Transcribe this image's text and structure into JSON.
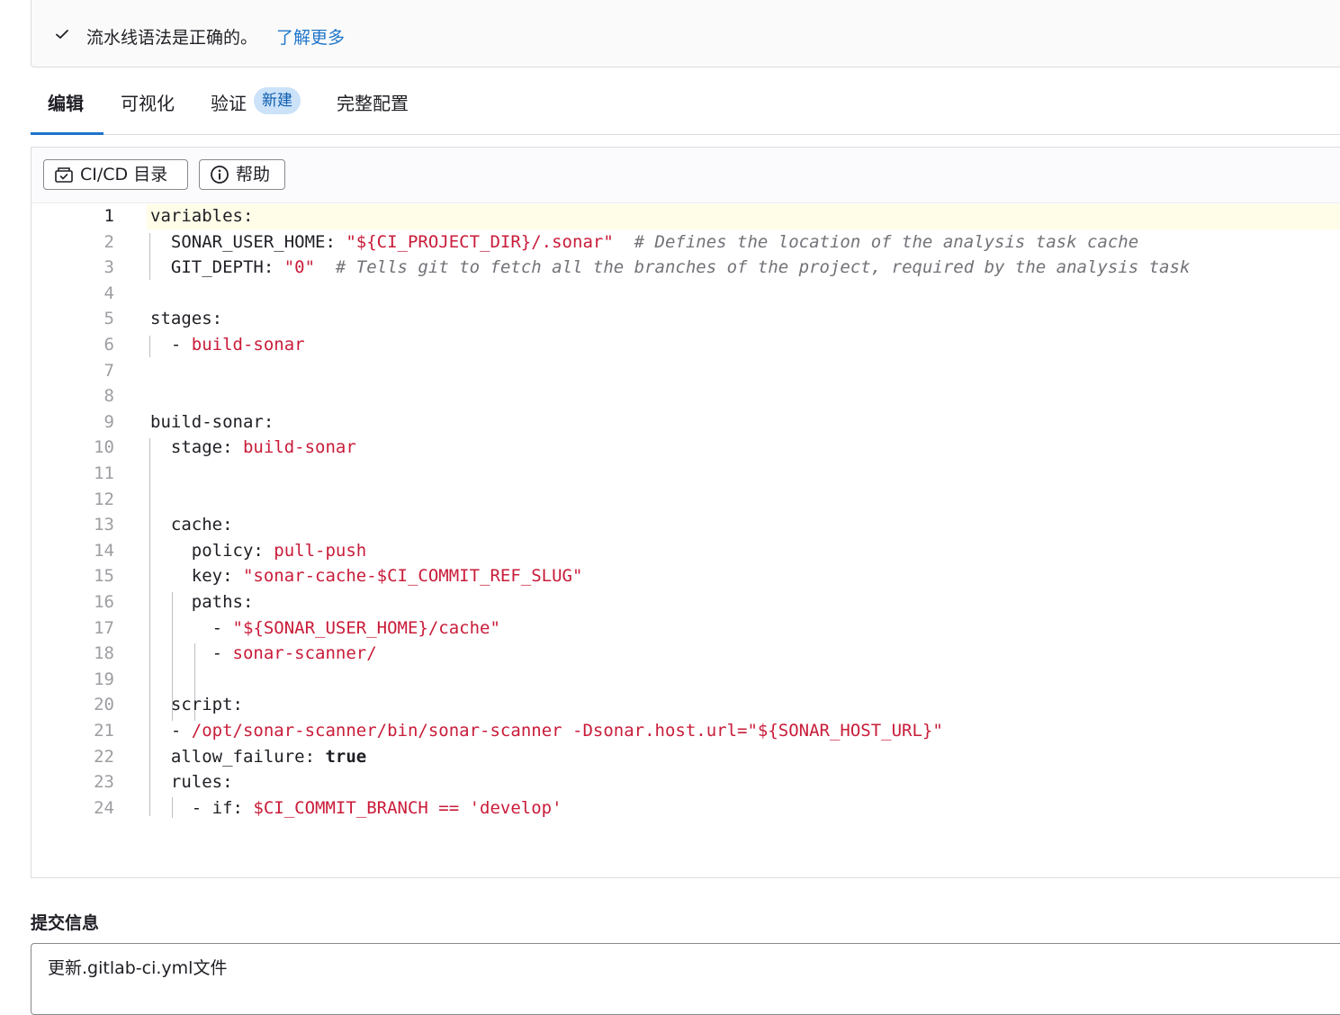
{
  "banner": {
    "message": "流水线语法是正确的。",
    "link": "了解更多"
  },
  "tabs": [
    {
      "label": "编辑"
    },
    {
      "label": "可视化"
    },
    {
      "label": "验证",
      "badge": "新建"
    },
    {
      "label": "完整配置"
    }
  ],
  "toolbar": {
    "catalog_label": "CI/CD 目录",
    "help_label": "帮助"
  },
  "editor": {
    "line_numbers": [
      "1",
      "2",
      "3",
      "4",
      "5",
      "6",
      "7",
      "8",
      "9",
      "10",
      "11",
      "12",
      "13",
      "14",
      "15",
      "16",
      "17",
      "18",
      "19",
      "20",
      "21",
      "22",
      "23",
      "24"
    ],
    "current_line": "1",
    "lines": [
      [
        {
          "t": "variables:",
          "k": "p"
        }
      ],
      [
        {
          "t": "  SONAR_USER_HOME: ",
          "k": "p"
        },
        {
          "t": "\"${CI_PROJECT_DIR}/.sonar\"",
          "k": "s"
        },
        {
          "t": "  # Defines the location of the analysis task cache",
          "k": "c"
        }
      ],
      [
        {
          "t": "  GIT_DEPTH: ",
          "k": "p"
        },
        {
          "t": "\"0\"",
          "k": "s"
        },
        {
          "t": "  # Tells git to fetch all the branches of the project, required by the analysis task",
          "k": "c"
        }
      ],
      [],
      [
        {
          "t": "stages:",
          "k": "p"
        }
      ],
      [
        {
          "t": "  - ",
          "k": "p"
        },
        {
          "t": "build-sonar",
          "k": "s"
        }
      ],
      [],
      [],
      [
        {
          "t": "build-sonar:",
          "k": "p"
        }
      ],
      [
        {
          "t": "  stage: ",
          "k": "p"
        },
        {
          "t": "build-sonar",
          "k": "s"
        }
      ],
      [],
      [],
      [
        {
          "t": "  cache:",
          "k": "p"
        }
      ],
      [
        {
          "t": "    policy: ",
          "k": "p"
        },
        {
          "t": "pull-push",
          "k": "s"
        }
      ],
      [
        {
          "t": "    key: ",
          "k": "p"
        },
        {
          "t": "\"sonar-cache-$CI_COMMIT_REF_SLUG\"",
          "k": "s"
        }
      ],
      [
        {
          "t": "    paths:",
          "k": "p"
        }
      ],
      [
        {
          "t": "      - ",
          "k": "p"
        },
        {
          "t": "\"${SONAR_USER_HOME}/cache\"",
          "k": "s"
        }
      ],
      [
        {
          "t": "      - ",
          "k": "p"
        },
        {
          "t": "sonar-scanner/",
          "k": "s"
        }
      ],
      [],
      [
        {
          "t": "  script:",
          "k": "p"
        }
      ],
      [
        {
          "t": "  - ",
          "k": "p"
        },
        {
          "t": "/opt/sonar-scanner/bin/sonar-scanner -Dsonar.host.url=\"${SONAR_HOST_URL}\"",
          "k": "s"
        }
      ],
      [
        {
          "t": "  allow_failure: ",
          "k": "p"
        },
        {
          "t": "true",
          "k": "b"
        }
      ],
      [
        {
          "t": "  rules:",
          "k": "p"
        }
      ],
      [
        {
          "t": "    - if: ",
          "k": "p"
        },
        {
          "t": "$CI_COMMIT_BRANCH == 'develop'",
          "k": "s"
        }
      ]
    ]
  },
  "commit": {
    "label": "提交信息",
    "value": "更新.gitlab-ci.yml文件"
  },
  "icons": {
    "banner_status": "check-icon",
    "catalog": "catalog-icon",
    "help": "info-circle-icon"
  },
  "colors": {
    "link": "#1f75cb",
    "badge_bg": "#cbe2f9",
    "string": "#c91c39",
    "comment": "#737278"
  }
}
